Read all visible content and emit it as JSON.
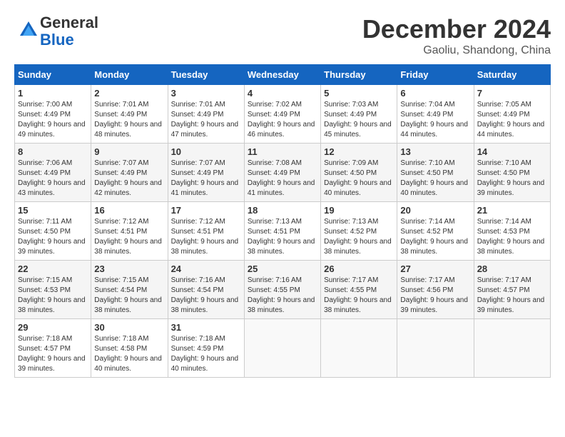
{
  "header": {
    "logo_general": "General",
    "logo_blue": "Blue",
    "month_year": "December 2024",
    "location": "Gaoliu, Shandong, China"
  },
  "weekdays": [
    "Sunday",
    "Monday",
    "Tuesday",
    "Wednesday",
    "Thursday",
    "Friday",
    "Saturday"
  ],
  "weeks": [
    [
      {
        "day": "1",
        "sunrise": "7:00 AM",
        "sunset": "4:49 PM",
        "daylight": "9 hours and 49 minutes."
      },
      {
        "day": "2",
        "sunrise": "7:01 AM",
        "sunset": "4:49 PM",
        "daylight": "9 hours and 48 minutes."
      },
      {
        "day": "3",
        "sunrise": "7:01 AM",
        "sunset": "4:49 PM",
        "daylight": "9 hours and 47 minutes."
      },
      {
        "day": "4",
        "sunrise": "7:02 AM",
        "sunset": "4:49 PM",
        "daylight": "9 hours and 46 minutes."
      },
      {
        "day": "5",
        "sunrise": "7:03 AM",
        "sunset": "4:49 PM",
        "daylight": "9 hours and 45 minutes."
      },
      {
        "day": "6",
        "sunrise": "7:04 AM",
        "sunset": "4:49 PM",
        "daylight": "9 hours and 44 minutes."
      },
      {
        "day": "7",
        "sunrise": "7:05 AM",
        "sunset": "4:49 PM",
        "daylight": "9 hours and 44 minutes."
      }
    ],
    [
      {
        "day": "8",
        "sunrise": "7:06 AM",
        "sunset": "4:49 PM",
        "daylight": "9 hours and 43 minutes."
      },
      {
        "day": "9",
        "sunrise": "7:07 AM",
        "sunset": "4:49 PM",
        "daylight": "9 hours and 42 minutes."
      },
      {
        "day": "10",
        "sunrise": "7:07 AM",
        "sunset": "4:49 PM",
        "daylight": "9 hours and 41 minutes."
      },
      {
        "day": "11",
        "sunrise": "7:08 AM",
        "sunset": "4:49 PM",
        "daylight": "9 hours and 41 minutes."
      },
      {
        "day": "12",
        "sunrise": "7:09 AM",
        "sunset": "4:50 PM",
        "daylight": "9 hours and 40 minutes."
      },
      {
        "day": "13",
        "sunrise": "7:10 AM",
        "sunset": "4:50 PM",
        "daylight": "9 hours and 40 minutes."
      },
      {
        "day": "14",
        "sunrise": "7:10 AM",
        "sunset": "4:50 PM",
        "daylight": "9 hours and 39 minutes."
      }
    ],
    [
      {
        "day": "15",
        "sunrise": "7:11 AM",
        "sunset": "4:50 PM",
        "daylight": "9 hours and 39 minutes."
      },
      {
        "day": "16",
        "sunrise": "7:12 AM",
        "sunset": "4:51 PM",
        "daylight": "9 hours and 38 minutes."
      },
      {
        "day": "17",
        "sunrise": "7:12 AM",
        "sunset": "4:51 PM",
        "daylight": "9 hours and 38 minutes."
      },
      {
        "day": "18",
        "sunrise": "7:13 AM",
        "sunset": "4:51 PM",
        "daylight": "9 hours and 38 minutes."
      },
      {
        "day": "19",
        "sunrise": "7:13 AM",
        "sunset": "4:52 PM",
        "daylight": "9 hours and 38 minutes."
      },
      {
        "day": "20",
        "sunrise": "7:14 AM",
        "sunset": "4:52 PM",
        "daylight": "9 hours and 38 minutes."
      },
      {
        "day": "21",
        "sunrise": "7:14 AM",
        "sunset": "4:53 PM",
        "daylight": "9 hours and 38 minutes."
      }
    ],
    [
      {
        "day": "22",
        "sunrise": "7:15 AM",
        "sunset": "4:53 PM",
        "daylight": "9 hours and 38 minutes."
      },
      {
        "day": "23",
        "sunrise": "7:15 AM",
        "sunset": "4:54 PM",
        "daylight": "9 hours and 38 minutes."
      },
      {
        "day": "24",
        "sunrise": "7:16 AM",
        "sunset": "4:54 PM",
        "daylight": "9 hours and 38 minutes."
      },
      {
        "day": "25",
        "sunrise": "7:16 AM",
        "sunset": "4:55 PM",
        "daylight": "9 hours and 38 minutes."
      },
      {
        "day": "26",
        "sunrise": "7:17 AM",
        "sunset": "4:55 PM",
        "daylight": "9 hours and 38 minutes."
      },
      {
        "day": "27",
        "sunrise": "7:17 AM",
        "sunset": "4:56 PM",
        "daylight": "9 hours and 39 minutes."
      },
      {
        "day": "28",
        "sunrise": "7:17 AM",
        "sunset": "4:57 PM",
        "daylight": "9 hours and 39 minutes."
      }
    ],
    [
      {
        "day": "29",
        "sunrise": "7:18 AM",
        "sunset": "4:57 PM",
        "daylight": "9 hours and 39 minutes."
      },
      {
        "day": "30",
        "sunrise": "7:18 AM",
        "sunset": "4:58 PM",
        "daylight": "9 hours and 40 minutes."
      },
      {
        "day": "31",
        "sunrise": "7:18 AM",
        "sunset": "4:59 PM",
        "daylight": "9 hours and 40 minutes."
      },
      null,
      null,
      null,
      null
    ]
  ]
}
